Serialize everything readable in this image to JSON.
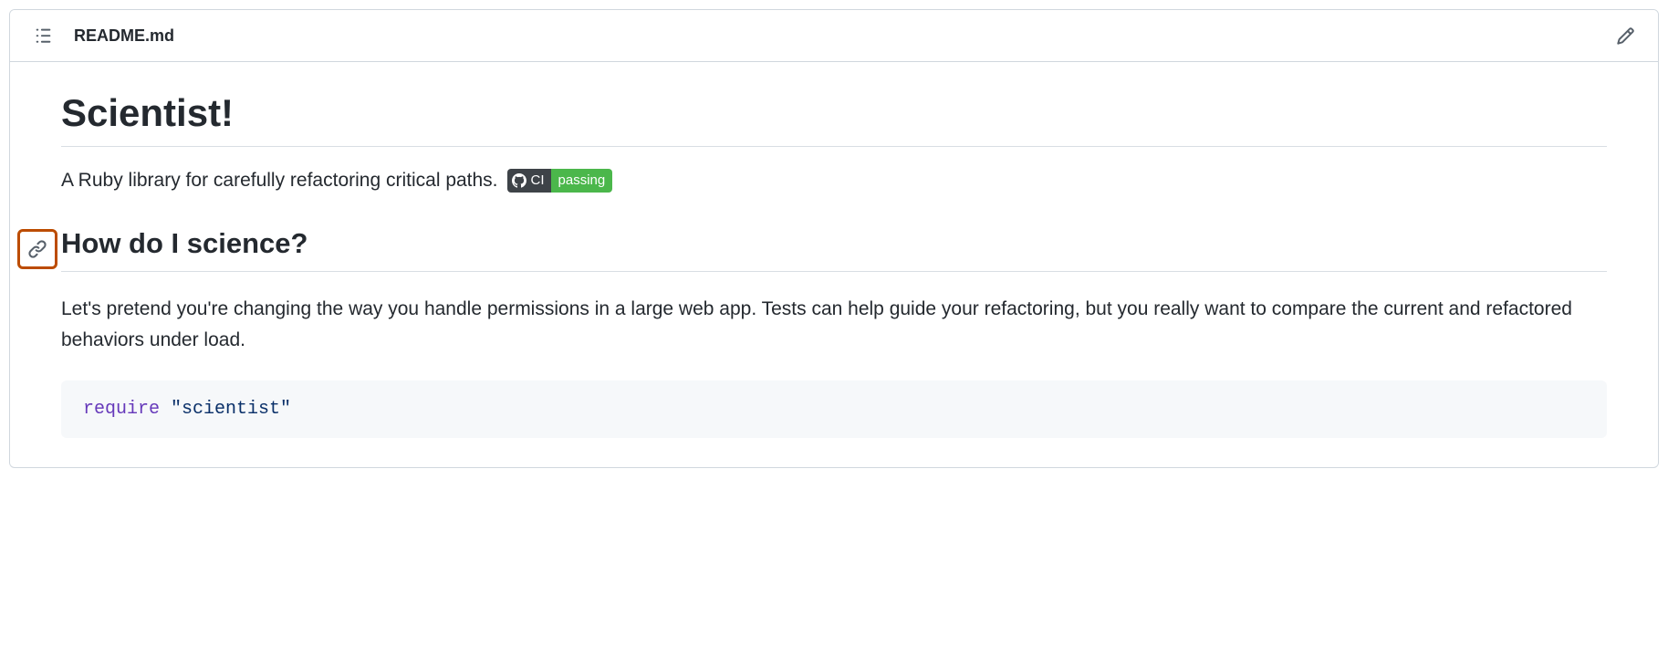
{
  "header": {
    "filename": "README.md"
  },
  "content": {
    "title": "Scientist!",
    "description": "A Ruby library for carefully refactoring critical paths.",
    "badge": {
      "label": "CI",
      "status": "passing"
    },
    "section1": {
      "heading": "How do I science?",
      "paragraph": "Let's pretend you're changing the way you handle permissions in a large web app. Tests can help guide your refactoring, but you really want to compare the current and refactored behaviors under load."
    },
    "code": {
      "keyword": "require",
      "string": "\"scientist\""
    }
  }
}
